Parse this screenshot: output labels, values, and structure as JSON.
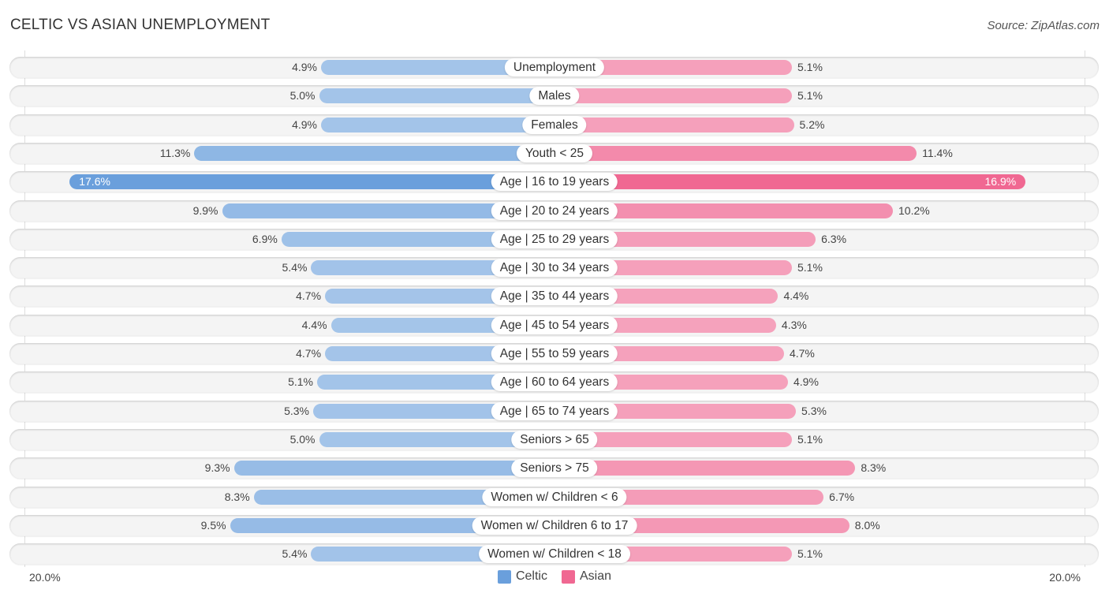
{
  "header": {
    "title": "CELTIC VS ASIAN UNEMPLOYMENT",
    "source": "Source: ZipAtlas.com"
  },
  "legend": {
    "celtic_label": "Celtic",
    "asian_label": "Asian"
  },
  "axis": {
    "left_label": "20.0%",
    "right_label": "20.0%"
  },
  "colors": {
    "celtic": "#6a9fdc",
    "celtic_light": "#a8c7ea",
    "asian": "#f06892",
    "asian_light": "#f5a6bf"
  },
  "chart_data": {
    "type": "bar",
    "orientation": "horizontal-diverging",
    "title": "CELTIC VS ASIAN UNEMPLOYMENT",
    "xlabel": "",
    "ylabel": "",
    "xlim": [
      -20,
      20
    ],
    "legend_position": "bottom-center",
    "categories": [
      "Unemployment",
      "Males",
      "Females",
      "Youth < 25",
      "Age | 16 to 19 years",
      "Age | 20 to 24 years",
      "Age | 25 to 29 years",
      "Age | 30 to 34 years",
      "Age | 35 to 44 years",
      "Age | 45 to 54 years",
      "Age | 55 to 59 years",
      "Age | 60 to 64 years",
      "Age | 65 to 74 years",
      "Seniors > 65",
      "Seniors > 75",
      "Women w/ Children < 6",
      "Women w/ Children 6 to 17",
      "Women w/ Children < 18"
    ],
    "series": [
      {
        "name": "Celtic",
        "side": "left",
        "values": [
          4.9,
          5.0,
          4.9,
          11.3,
          17.6,
          9.9,
          6.9,
          5.4,
          4.7,
          4.4,
          4.7,
          5.1,
          5.3,
          5.0,
          9.3,
          8.3,
          9.5,
          5.4
        ],
        "labels": [
          "4.9%",
          "5.0%",
          "4.9%",
          "11.3%",
          "17.6%",
          "9.9%",
          "6.9%",
          "5.4%",
          "4.7%",
          "4.4%",
          "4.7%",
          "5.1%",
          "5.3%",
          "5.0%",
          "9.3%",
          "8.3%",
          "9.5%",
          "5.4%"
        ]
      },
      {
        "name": "Asian",
        "side": "right",
        "values": [
          5.1,
          5.1,
          5.2,
          11.4,
          16.9,
          10.2,
          6.3,
          5.1,
          4.4,
          4.3,
          4.7,
          4.9,
          5.3,
          5.1,
          8.3,
          6.7,
          8.0,
          5.1
        ],
        "labels": [
          "5.1%",
          "5.1%",
          "5.2%",
          "11.4%",
          "16.9%",
          "10.2%",
          "6.3%",
          "5.1%",
          "4.4%",
          "4.3%",
          "4.7%",
          "4.9%",
          "5.3%",
          "5.1%",
          "8.3%",
          "6.7%",
          "8.0%",
          "5.1%"
        ]
      }
    ]
  }
}
